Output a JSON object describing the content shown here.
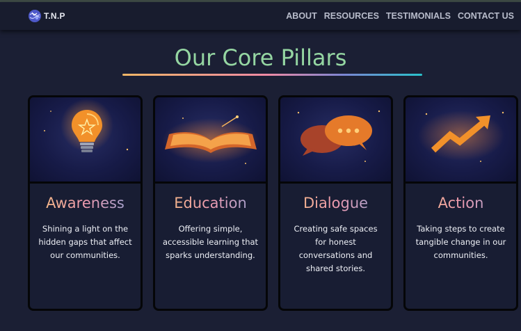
{
  "brand": {
    "name": "T.N.P",
    "icon": "globe-logo-icon"
  },
  "nav": {
    "links": [
      "ABOUT",
      "RESOURCES",
      "TESTIMONIALS",
      "CONTACT US"
    ]
  },
  "section": {
    "title": "Our Core Pillars"
  },
  "pillars": [
    {
      "title": "Awareness",
      "description": "Shining a light on the hidden gaps that affect our communities.",
      "icon": "lightbulb-icon"
    },
    {
      "title": "Education",
      "description": "Offering simple, accessible learning that sparks understanding.",
      "icon": "open-book-icon"
    },
    {
      "title": "Dialogue",
      "description": "Creating safe spaces for honest conversations and shared stories.",
      "icon": "speech-bubbles-icon"
    },
    {
      "title": "Action",
      "description": "Taking steps to create tangible change in our communities.",
      "icon": "rising-arrow-icon"
    }
  ],
  "colors": {
    "background": "#1b1f34",
    "navbar": "#181c2e",
    "title": "#95d6a2",
    "accent_orange": "#f2912a",
    "card_bg": "#181d33"
  }
}
